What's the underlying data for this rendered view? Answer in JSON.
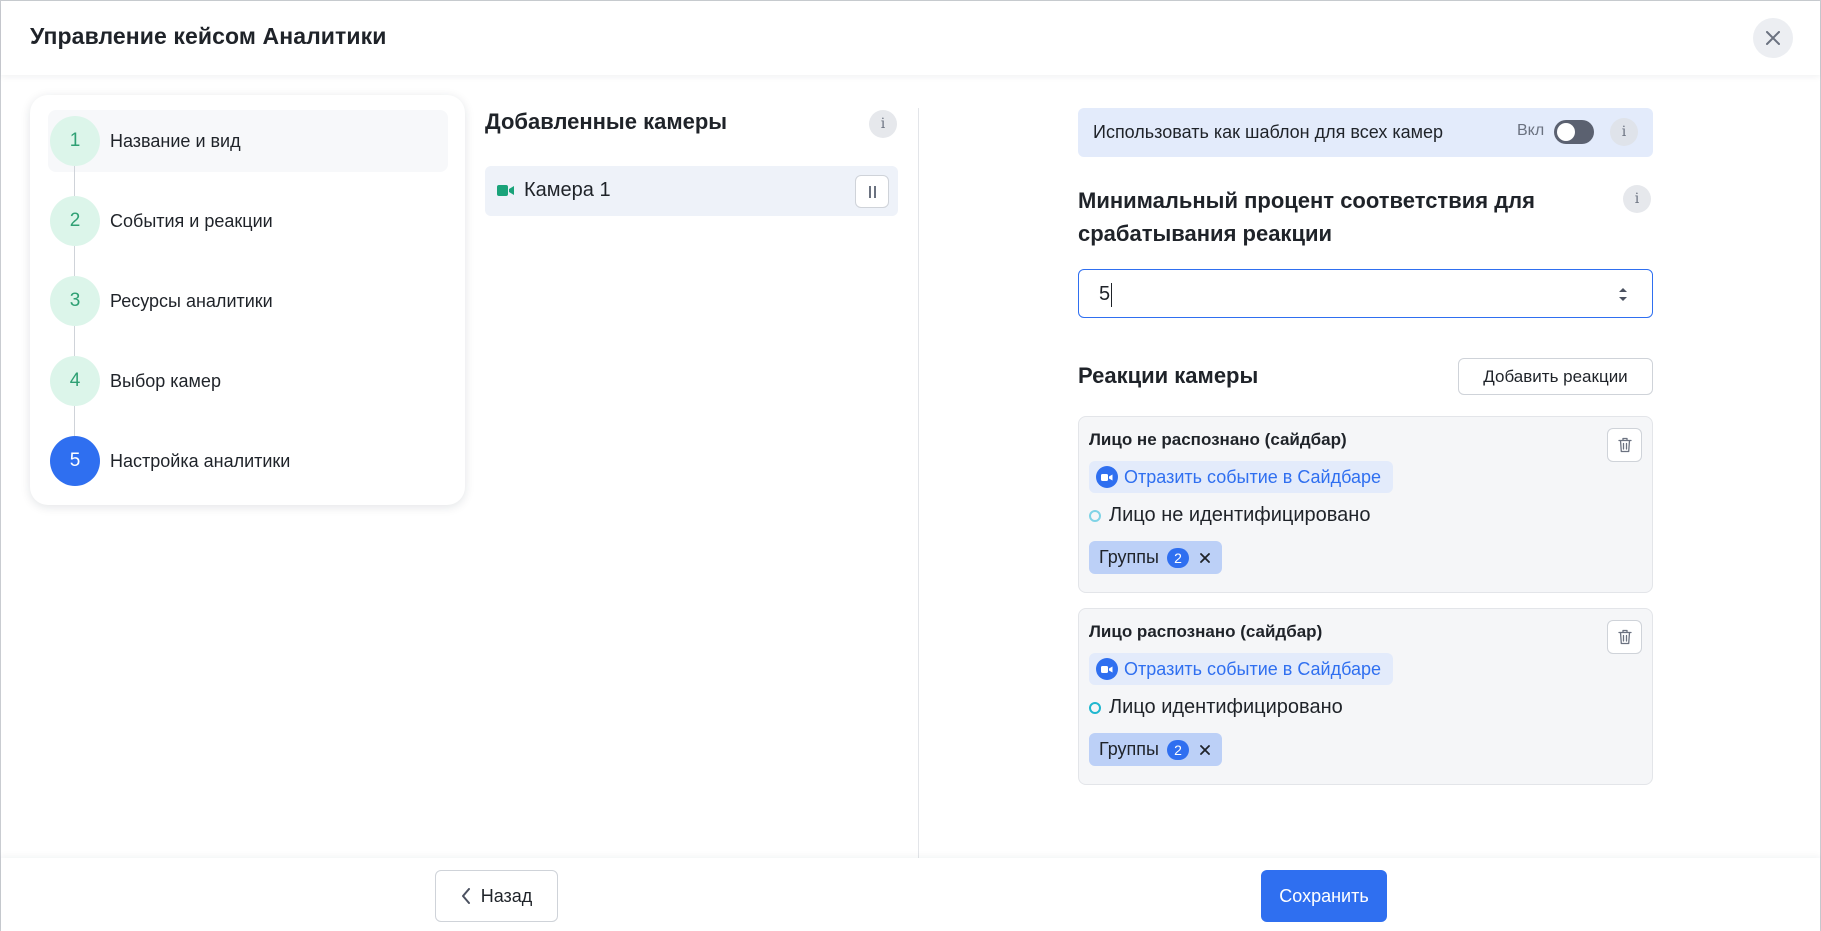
{
  "header": {
    "title": "Управление кейсом Аналитики",
    "close_icon": "close-icon"
  },
  "steps": [
    {
      "number": "1",
      "label": "Название и вид",
      "state": "done"
    },
    {
      "number": "2",
      "label": "События и реакции",
      "state": "done"
    },
    {
      "number": "3",
      "label": "Ресурсы аналитики",
      "state": "done"
    },
    {
      "number": "4",
      "label": "Выбор камер",
      "state": "done"
    },
    {
      "number": "5",
      "label": "Настройка аналитики",
      "state": "active"
    }
  ],
  "cameras": {
    "title": "Добавленные камеры",
    "info": "i",
    "items": [
      {
        "label": "Камера 1",
        "icon": "video-camera-icon",
        "action_icon": "pause-icon"
      }
    ]
  },
  "settings": {
    "template": {
      "label": "Использовать как шаблон для всех камер",
      "toggle_label": "Вкл",
      "toggle_on": false,
      "info": "i"
    },
    "min_percent": {
      "title": "Минимальный процент соответствия для срабатывания реакции",
      "value": "5",
      "info": "i"
    },
    "reactions": {
      "title": "Реакции камеры",
      "add_label": "Добавить реакции",
      "items": [
        {
          "title": "Лицо не распознано (сайдбар)",
          "action": "Отразить событие в Сайдбаре",
          "event": "Лицо не идентифицировано",
          "groups_label": "Группы",
          "groups_count": "2"
        },
        {
          "title": "Лицо распознано (сайдбар)",
          "action": "Отразить событие в Сайдбаре",
          "event": "Лицо идентифицировано",
          "groups_label": "Группы",
          "groups_count": "2"
        }
      ]
    }
  },
  "footer": {
    "back_label": "Назад",
    "save_label": "Сохранить"
  },
  "colors": {
    "accent": "#2f6ff0",
    "step_done_bg": "#dcf5ea",
    "step_done_text": "#2fa074",
    "camera_green": "#1aa37a"
  }
}
